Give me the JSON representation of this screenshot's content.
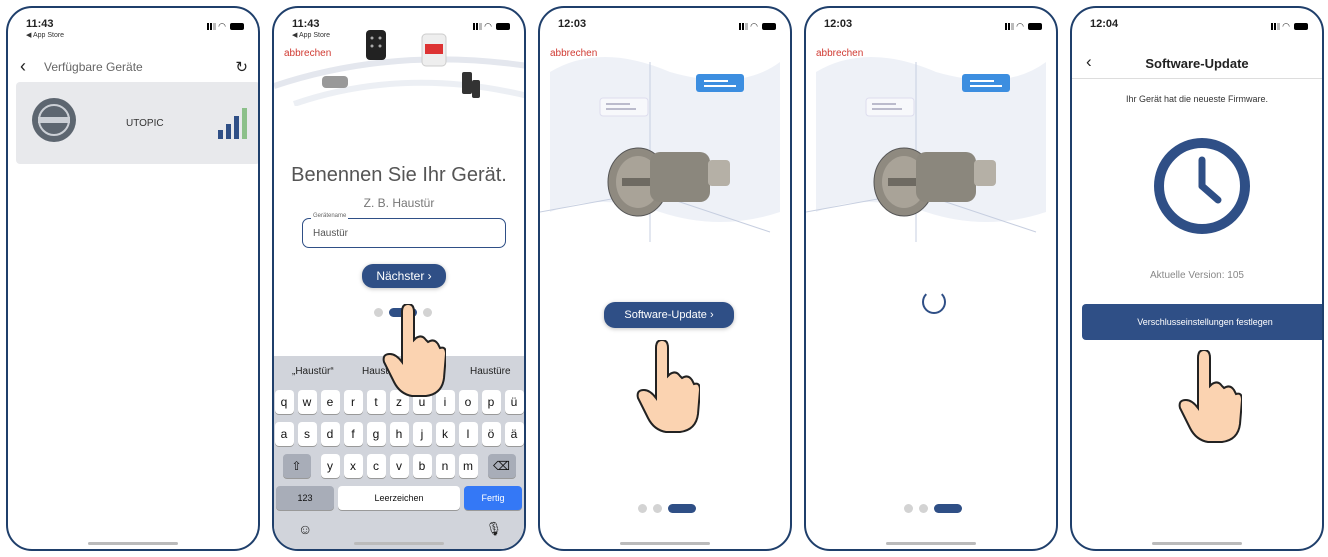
{
  "screens": {
    "available": {
      "time": "11:43",
      "back_app": "◀ App Store",
      "title": "Verfügbare Geräte",
      "device_name": "UTOPIC"
    },
    "naming": {
      "time": "11:43",
      "back_app": "◀ App Store",
      "abort": "abbrechen",
      "heading": "Benennen Sie Ihr Gerät.",
      "example": "Z. B. Haustür",
      "field_label": "Gerätename",
      "field_value": "Haustür",
      "next_label": "Nächster  ›",
      "suggestions": [
        "„Haustür“",
        "Haustür",
        "Haustüre"
      ],
      "keyboard": {
        "row1": [
          "q",
          "w",
          "e",
          "r",
          "t",
          "z",
          "u",
          "i",
          "o",
          "p",
          "ü"
        ],
        "row2": [
          "a",
          "s",
          "d",
          "f",
          "g",
          "h",
          "j",
          "k",
          "l",
          "ö",
          "ä"
        ],
        "row3": [
          "y",
          "x",
          "c",
          "v",
          "b",
          "n",
          "m"
        ],
        "shift": "⇧",
        "backspace": "⌫",
        "numbers": "123",
        "space": "Leerzeichen",
        "done": "Fertig",
        "emoji": "☺",
        "mic": "🎙"
      }
    },
    "update_prompt": {
      "time": "12:03",
      "abort": "abbrechen",
      "button": "Software-Update  ›"
    },
    "updating": {
      "time": "12:03",
      "abort": "abbrechen"
    },
    "update_done": {
      "time": "12:04",
      "title": "Software-Update",
      "message": "Ihr Gerät hat die neueste Firmware.",
      "version": "Aktuelle Version: 105",
      "button": "Verschlusseinstellungen festlegen"
    }
  },
  "colors": {
    "primary": "#2f4f86",
    "abort": "#d03a32",
    "keyboard": "#d1d4db",
    "done_key": "#3478f6"
  }
}
